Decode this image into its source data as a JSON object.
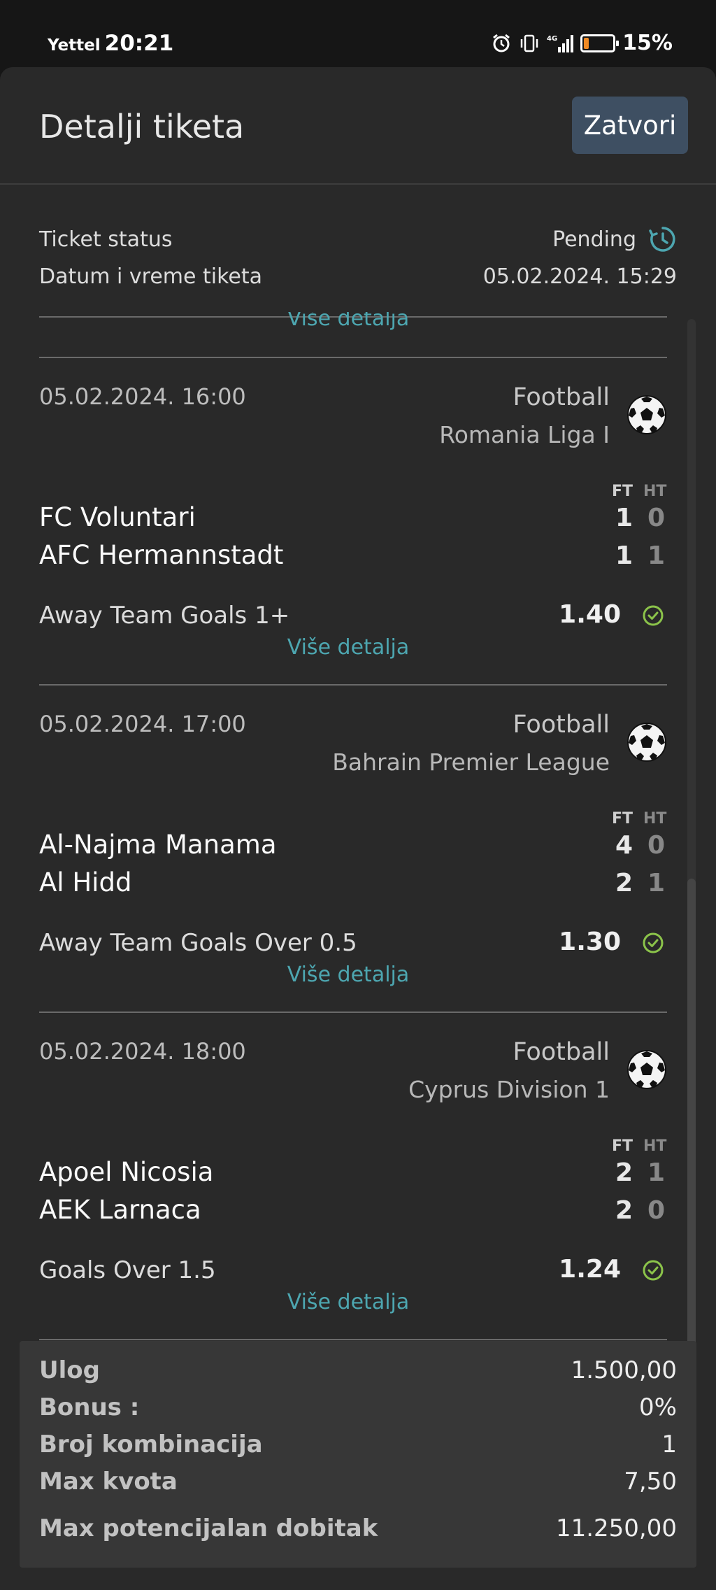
{
  "status_bar": {
    "carrier": "Yettel",
    "time": "20:21",
    "network": "4G",
    "battery_percent": "15%",
    "battery_level": 0.15,
    "icons": [
      "alarm-icon",
      "vibrate-icon",
      "signal-icon",
      "battery-icon"
    ]
  },
  "header": {
    "title": "Detalji tiketa",
    "close_label": "Zatvori"
  },
  "ticket": {
    "status_label": "Ticket status",
    "status_value": "Pending",
    "datetime_label": "Datum i vreme tiketa",
    "datetime_value": "05.02.2024. 15:29",
    "partial_more_label": "Više detalja"
  },
  "columns": {
    "ft": "FT",
    "ht": "HT"
  },
  "matches": [
    {
      "date": "05.02.2024. 16:00",
      "sport": "Football",
      "league": "Romania Liga I",
      "home": "FC Voluntari",
      "away": "AFC Hermannstadt",
      "home_ft": "1",
      "home_ht": "0",
      "away_ft": "1",
      "away_ht": "1",
      "pick": "Away Team Goals 1+",
      "odds": "1.40",
      "more": "Više detalja"
    },
    {
      "date": "05.02.2024. 17:00",
      "sport": "Football",
      "league": "Bahrain Premier League",
      "home": "Al-Najma Manama",
      "away": "Al Hidd",
      "home_ft": "4",
      "home_ht": "0",
      "away_ft": "2",
      "away_ht": "1",
      "pick": "Away Team Goals Over 0.5",
      "odds": "1.30",
      "more": "Više detalja"
    },
    {
      "date": "05.02.2024. 18:00",
      "sport": "Football",
      "league": "Cyprus Division 1",
      "home": "Apoel Nicosia",
      "away": "AEK Larnaca",
      "home_ft": "2",
      "home_ht": "1",
      "away_ft": "2",
      "away_ht": "0",
      "pick": "Goals Over 1.5",
      "odds": "1.24",
      "more": "Više detalja"
    }
  ],
  "summary": {
    "stake_label": "Ulog",
    "stake_value": "1.500,00",
    "bonus_label": "Bonus :",
    "bonus_value": "0%",
    "combos_label": "Broj kombinacija",
    "combos_value": "1",
    "max_odds_label": "Max kvota",
    "max_odds_value": "7,50",
    "max_win_label": "Max potencijalan dobitak",
    "max_win_value": "11.250,00"
  },
  "colors": {
    "background": "#292929",
    "accent_link": "#4da6b0",
    "win_check": "#8bc34a",
    "close_button": "#3e4f62",
    "battery_low": "#f08a24"
  }
}
